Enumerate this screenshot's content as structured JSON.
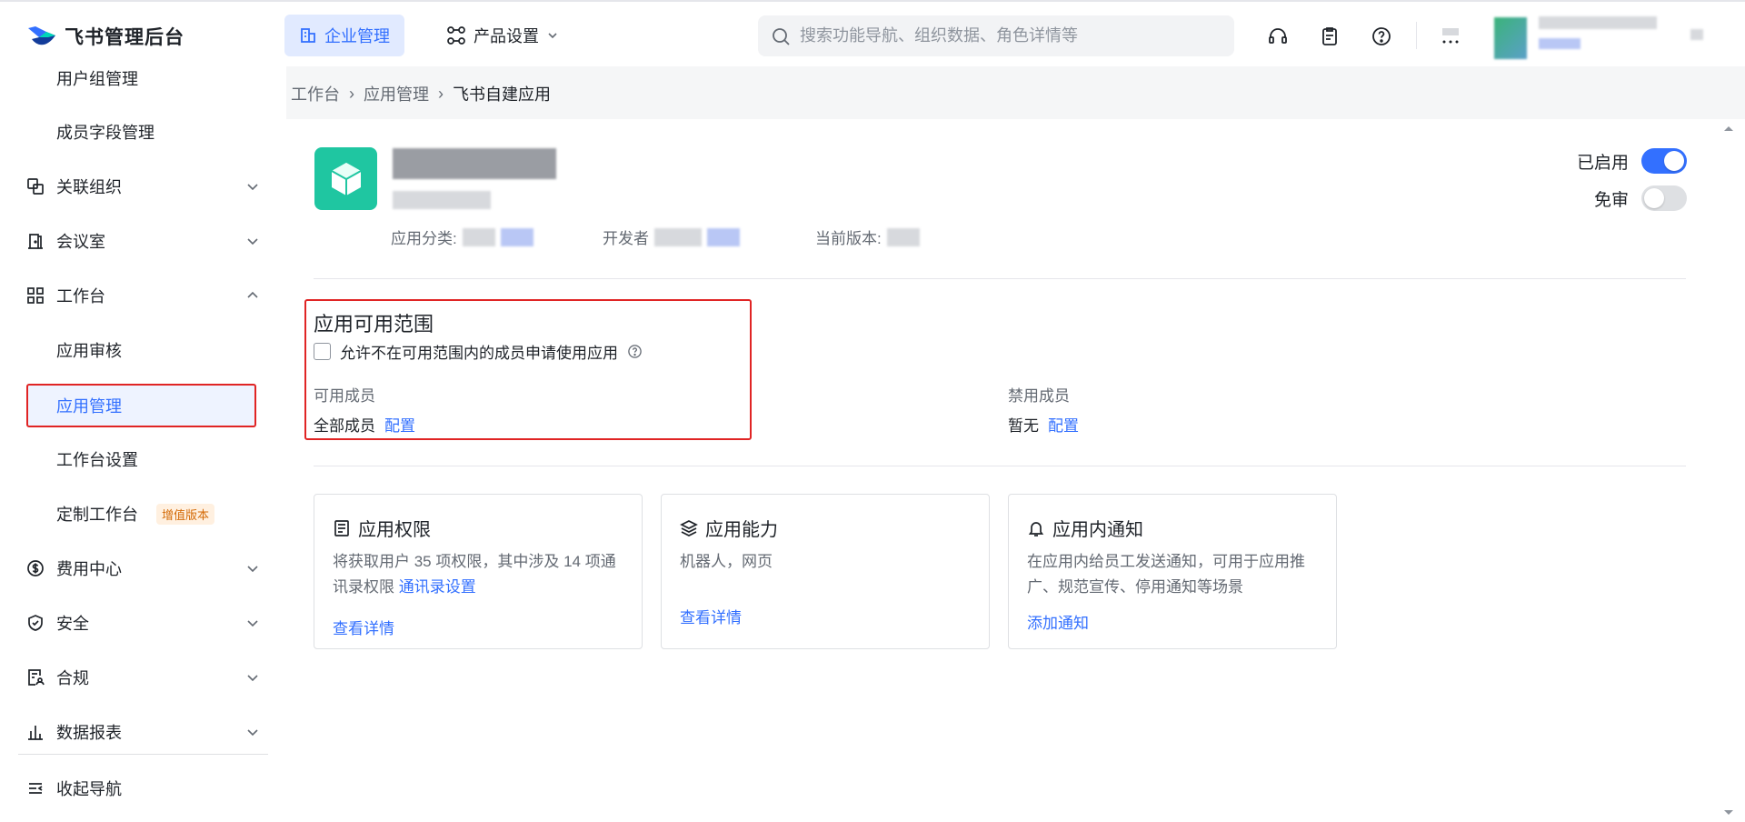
{
  "brand": {
    "name": "飞书管理后台"
  },
  "topnav": {
    "tabs": [
      {
        "label": "企业管理"
      },
      {
        "label": "产品设置"
      }
    ],
    "search_placeholder": "搜索功能导航、组织数据、角色详情等"
  },
  "sidebar": {
    "items": [
      {
        "label": "用户组管理"
      },
      {
        "label": "成员字段管理"
      },
      {
        "label": "关联组织"
      },
      {
        "label": "会议室"
      },
      {
        "label": "工作台"
      },
      {
        "label": "应用审核"
      },
      {
        "label": "应用管理"
      },
      {
        "label": "工作台设置"
      },
      {
        "label": "定制工作台",
        "badge": "增值版本"
      },
      {
        "label": "费用中心"
      },
      {
        "label": "安全"
      },
      {
        "label": "合规"
      },
      {
        "label": "数据报表"
      }
    ],
    "collapse": "收起导航"
  },
  "breadcrumb": [
    "工作台",
    "应用管理",
    "飞书自建应用"
  ],
  "app": {
    "category_label": "应用分类:",
    "developer_label": "开发者",
    "version_label": "当前版本:",
    "enabled_label": "已启用",
    "enabled": true,
    "review_label": "免审",
    "review": false
  },
  "scope": {
    "title": "应用可用范围",
    "checkbox_label": "允许不在可用范围内的成员申请使用应用",
    "available_label": "可用成员",
    "available_value": "全部成员",
    "available_link": "配置",
    "disabled_label": "禁用成员",
    "disabled_value": "暂无",
    "disabled_link": "配置"
  },
  "cards": [
    {
      "title": "应用权限",
      "desc": "将获取用户 35 项权限，其中涉及 14 项通讯录权限",
      "inline_link": "通讯录设置",
      "link": "查看详情"
    },
    {
      "title": "应用能力",
      "desc": "机器人，网页",
      "link": "查看详情"
    },
    {
      "title": "应用内通知",
      "desc": "在应用内给员工发送通知，可用于应用推广、规范宣传、停用通知等场景",
      "link": "添加通知"
    }
  ],
  "colors": {
    "accent": "#3370ff",
    "highlight": "#e02424",
    "app_icon": "#1fc6a1"
  }
}
